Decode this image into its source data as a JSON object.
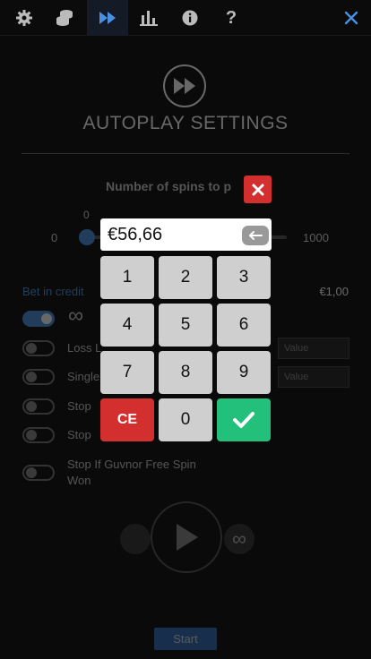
{
  "topbar": {
    "tabs": [
      {
        "icon": "gear-icon"
      },
      {
        "icon": "coins-icon"
      },
      {
        "icon": "fast-forward-icon",
        "active": true
      },
      {
        "icon": "bar-chart-icon"
      },
      {
        "icon": "info-icon"
      },
      {
        "icon": "help-icon"
      }
    ],
    "close_icon": "close-icon"
  },
  "settings": {
    "title": "AUTOPLAY SETTINGS",
    "spins_label": "Number of spins to p",
    "slider_min": "0",
    "slider_value": "0",
    "slider_max": "1000",
    "bet_label": "Bet in credit",
    "bet_value": "€1,00",
    "options": [
      {
        "label": "",
        "on": true
      },
      {
        "label": "Loss L",
        "on": false,
        "placeholder": "Value"
      },
      {
        "label": "Single",
        "on": false,
        "placeholder": "Value"
      },
      {
        "label": "Stop",
        "on": false
      },
      {
        "label": "Stop",
        "on": false
      },
      {
        "label_line1": "Stop If Guvnor Free Spin",
        "label_line2": "Won",
        "on": false
      }
    ],
    "start_label": "Start"
  },
  "keypad": {
    "display_value": "€56,66",
    "keys": [
      "1",
      "2",
      "3",
      "4",
      "5",
      "6",
      "7",
      "8",
      "9",
      "CE",
      "0"
    ],
    "colors": {
      "ce": "#d32f2f",
      "ok": "#22c07a",
      "close": "#d32f2f"
    }
  }
}
